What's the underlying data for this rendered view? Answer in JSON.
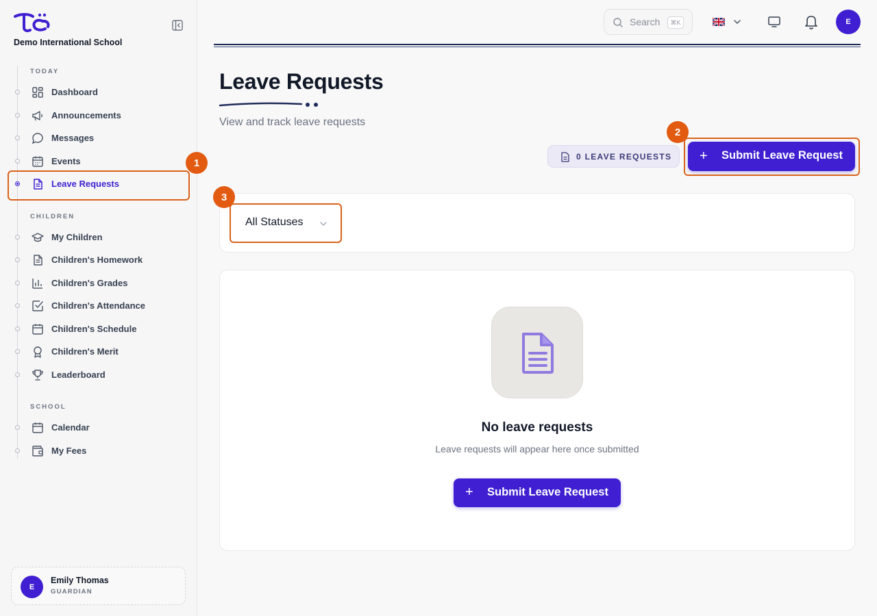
{
  "brand": {
    "school_name": "Demo International School",
    "accent": "#3f1fd1"
  },
  "sidebar": {
    "sections": [
      {
        "label": "TODAY"
      },
      {
        "label": "CHILDREN"
      },
      {
        "label": "SCHOOL"
      }
    ],
    "items": [
      {
        "label": "Dashboard",
        "icon": "dashboard-icon",
        "active": false
      },
      {
        "label": "Announcements",
        "icon": "megaphone-icon",
        "active": false
      },
      {
        "label": "Messages",
        "icon": "chat-bubble-icon",
        "active": false
      },
      {
        "label": "Events",
        "icon": "calendar-grid-icon",
        "active": false
      },
      {
        "label": "Leave Requests",
        "icon": "document-icon",
        "active": true
      },
      {
        "label": "My Children",
        "icon": "graduation-cap-icon",
        "active": false
      },
      {
        "label": "Children's Homework",
        "icon": "document-icon",
        "active": false
      },
      {
        "label": "Children's Grades",
        "icon": "bar-chart-icon",
        "active": false
      },
      {
        "label": "Children's Attendance",
        "icon": "check-square-icon",
        "active": false
      },
      {
        "label": "Children's Schedule",
        "icon": "calendar-icon",
        "active": false
      },
      {
        "label": "Children's Merit",
        "icon": "award-icon",
        "active": false
      },
      {
        "label": "Leaderboard",
        "icon": "trophy-icon",
        "active": false
      },
      {
        "label": "Calendar",
        "icon": "calendar-icon",
        "active": false
      },
      {
        "label": "My Fees",
        "icon": "wallet-icon",
        "active": false
      }
    ],
    "user": {
      "initial": "E",
      "name": "Emily Thomas",
      "role": "GUARDIAN"
    }
  },
  "topbar": {
    "search_placeholder": "Search",
    "search_shortcut": "⌘K",
    "language_icon": "uk-flag-icon",
    "avatar_initial": "E"
  },
  "page": {
    "title": "Leave Requests",
    "subtitle": "View and track leave requests",
    "count_badge": "0 LEAVE REQUESTS",
    "submit_button": "Submit Leave Request",
    "plus_glyph": "+"
  },
  "filter": {
    "status_selected": "All Statuses"
  },
  "empty_state": {
    "title": "No leave requests",
    "subtitle": "Leave requests will appear here once submitted",
    "button": "Submit Leave Request"
  },
  "annotations": [
    {
      "number": "1"
    },
    {
      "number": "2"
    },
    {
      "number": "3"
    }
  ],
  "colors": {
    "highlight": "#d9621a",
    "callout": "#e25b10",
    "accent": "#3f1fd1"
  }
}
